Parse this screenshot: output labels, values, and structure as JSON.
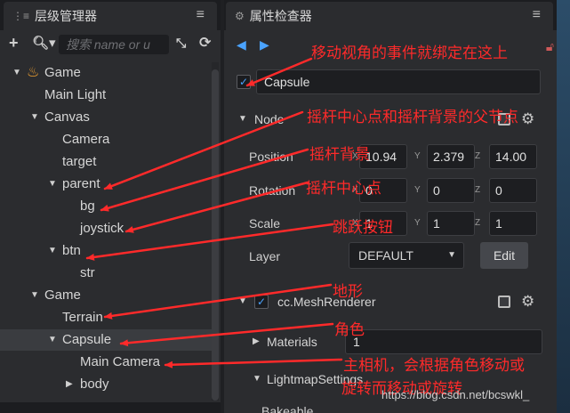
{
  "hierarchy": {
    "tab_title": "层级管理器",
    "search_placeholder": "搜索 name or u",
    "nodes": [
      {
        "label": "Game",
        "arrow": "▼",
        "icon": "fire"
      },
      {
        "label": "Main Light",
        "arrow": ""
      },
      {
        "label": "Canvas",
        "arrow": "▼"
      },
      {
        "label": "Camera",
        "arrow": ""
      },
      {
        "label": "target",
        "arrow": ""
      },
      {
        "label": "parent",
        "arrow": "▼"
      },
      {
        "label": "bg",
        "arrow": ""
      },
      {
        "label": "joystick",
        "arrow": ""
      },
      {
        "label": "btn",
        "arrow": "▼"
      },
      {
        "label": "str",
        "arrow": ""
      },
      {
        "label": "Game",
        "arrow": "▼"
      },
      {
        "label": "Terrain",
        "arrow": ""
      },
      {
        "label": "Capsule",
        "arrow": "▼",
        "selected": true
      },
      {
        "label": "Main Camera",
        "arrow": ""
      },
      {
        "label": "body",
        "arrow": "▶"
      }
    ]
  },
  "inspector": {
    "tab_title": "属性检查器",
    "node_name": "Capsule",
    "node_section": "Node",
    "position": {
      "label": "Position",
      "x": "10.94",
      "y": "2.379",
      "z": "14.00"
    },
    "rotation": {
      "label": "Rotation",
      "x": "0",
      "y": "0",
      "z": "0"
    },
    "scale": {
      "label": "Scale",
      "x": "1",
      "y": "1",
      "z": "1"
    },
    "layer": {
      "label": "Layer",
      "value": "DEFAULT",
      "edit_label": "Edit"
    },
    "mesh_renderer": "cc.MeshRenderer",
    "materials": {
      "label": "Materials",
      "value": "1"
    },
    "lightmap": "LightmapSettings",
    "bakeable": "Bakeable"
  },
  "axes": {
    "x": "X",
    "y": "Y",
    "z": "Z"
  },
  "annotations": [
    "移动视角的事件就绑定在这上",
    "摇杆中心点和摇杆背景的父节点",
    "摇杆背景",
    "摇杆中心点",
    "跳跃按钮",
    "地形",
    "角色",
    "主相机，会根据角色移动或",
    "旋转而移动或旋转"
  ],
  "watermark": "https://blog.csdn.net/bcswkl_",
  "colors": {
    "annotation": "#ff2a2a",
    "accent": "#4aa3ff",
    "lock": "#cf5959"
  }
}
